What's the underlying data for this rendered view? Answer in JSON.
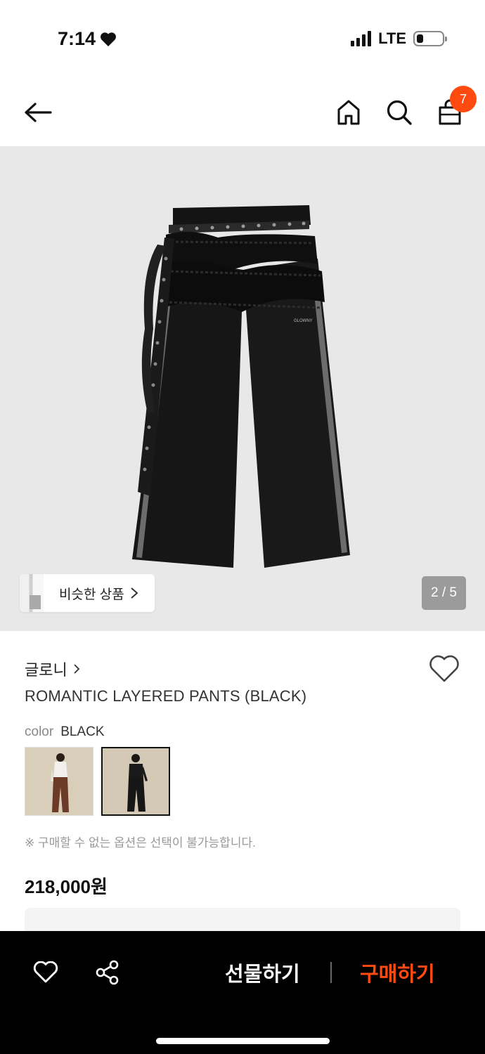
{
  "status": {
    "time": "7:14",
    "network": "LTE"
  },
  "header": {
    "cart_count": "7"
  },
  "gallery": {
    "similar_label": "비슷한 상품",
    "page_indicator": "2 / 5",
    "waistband_text": "GLOWNY"
  },
  "product": {
    "brand": "글로니",
    "title": "ROMANTIC LAYERED PANTS (BLACK)",
    "color_label": "color",
    "color_value": "BLACK",
    "notice": "※ 구매할 수 없는 옵션은 선택이 불가능합니다.",
    "price": "218,000원"
  },
  "bottom_bar": {
    "gift_label": "선물하기",
    "buy_label": "구매하기"
  },
  "colors": {
    "accent": "#ff4a10",
    "gallery_bg": "#e8e8e8",
    "bottom_bar_bg": "#000000"
  }
}
